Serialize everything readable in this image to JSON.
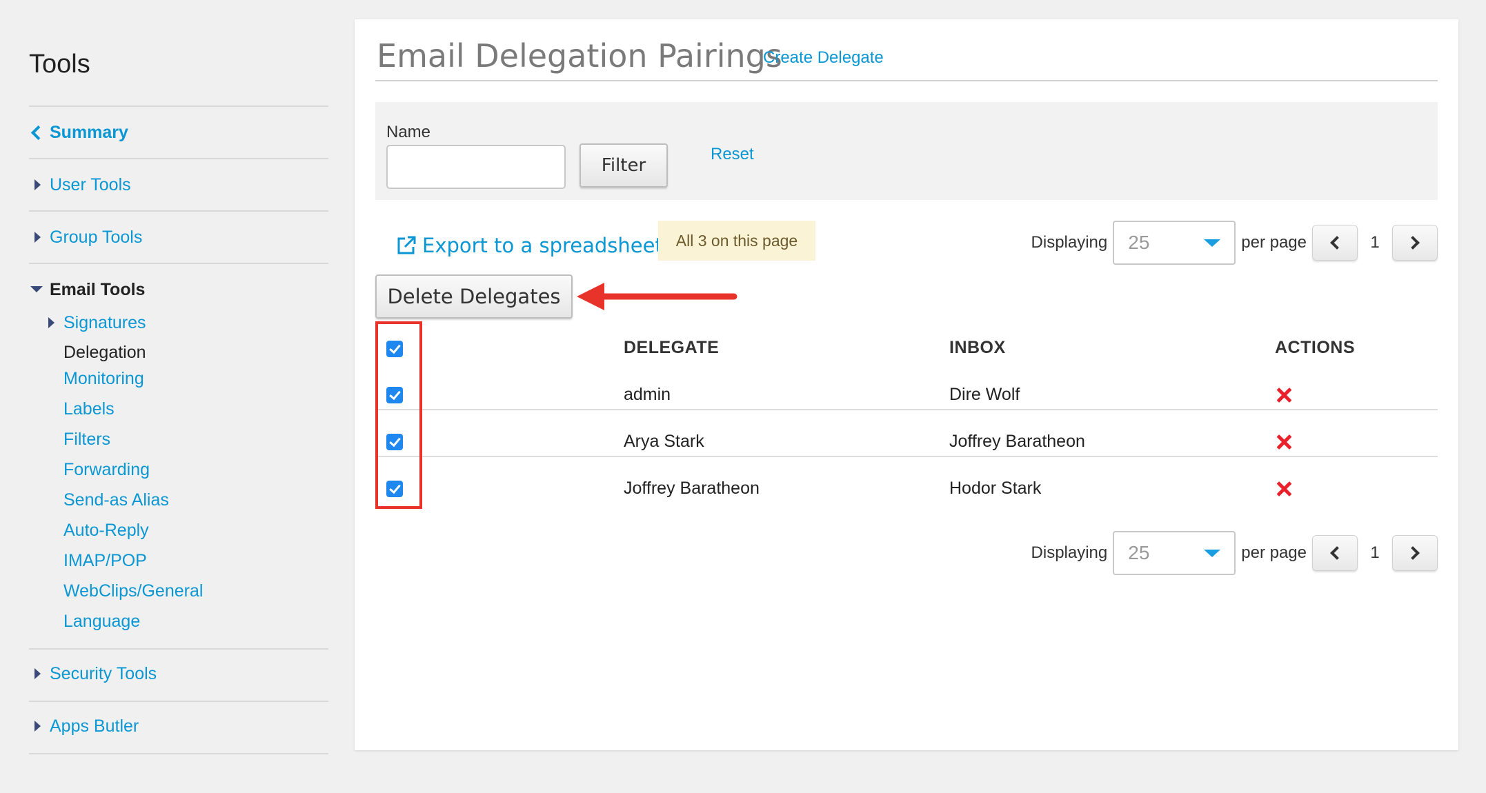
{
  "sidebar": {
    "title": "Tools",
    "summary": "Summary",
    "user_tools": "User Tools",
    "group_tools": "Group Tools",
    "email_tools": "Email Tools",
    "email_sub": [
      "Signatures",
      "Delegation",
      "Monitoring",
      "Labels",
      "Filters",
      "Forwarding",
      "Send-as Alias",
      "Auto-Reply",
      "IMAP/POP",
      "WebClips/General",
      "Language"
    ],
    "current_sub": "Delegation",
    "security_tools": "Security Tools",
    "apps_butler": "Apps Butler"
  },
  "main": {
    "title": "Email Delegation Pairings",
    "create_link": "Create Delegate",
    "filter": {
      "name_label": "Name",
      "name_value": "",
      "filter_button": "Filter",
      "reset_link": "Reset"
    },
    "export_link": "Export to a spreadsheet",
    "selection_badge": "All 3 on this page",
    "pager": {
      "displaying_label": "Displaying",
      "per_page_value": "25",
      "per_page_label": "per page",
      "page": "1"
    },
    "delete_button": "Delete Delegates",
    "table": {
      "columns": [
        "DELEGATE",
        "INBOX",
        "ACTIONS"
      ],
      "rows": [
        {
          "delegate": "admin",
          "inbox": "Dire Wolf",
          "checked": true
        },
        {
          "delegate": "Arya Stark",
          "inbox": "Joffrey Baratheon",
          "checked": true
        },
        {
          "delegate": "Joffrey Baratheon",
          "inbox": "Hodor Stark",
          "checked": true
        }
      ]
    }
  },
  "colors": {
    "link": "#0b97d3",
    "checkbox": "#1f88f0",
    "delete_x": "#e8212b",
    "annotation": "#e8332a",
    "badge_bg": "#fbf3d5"
  }
}
